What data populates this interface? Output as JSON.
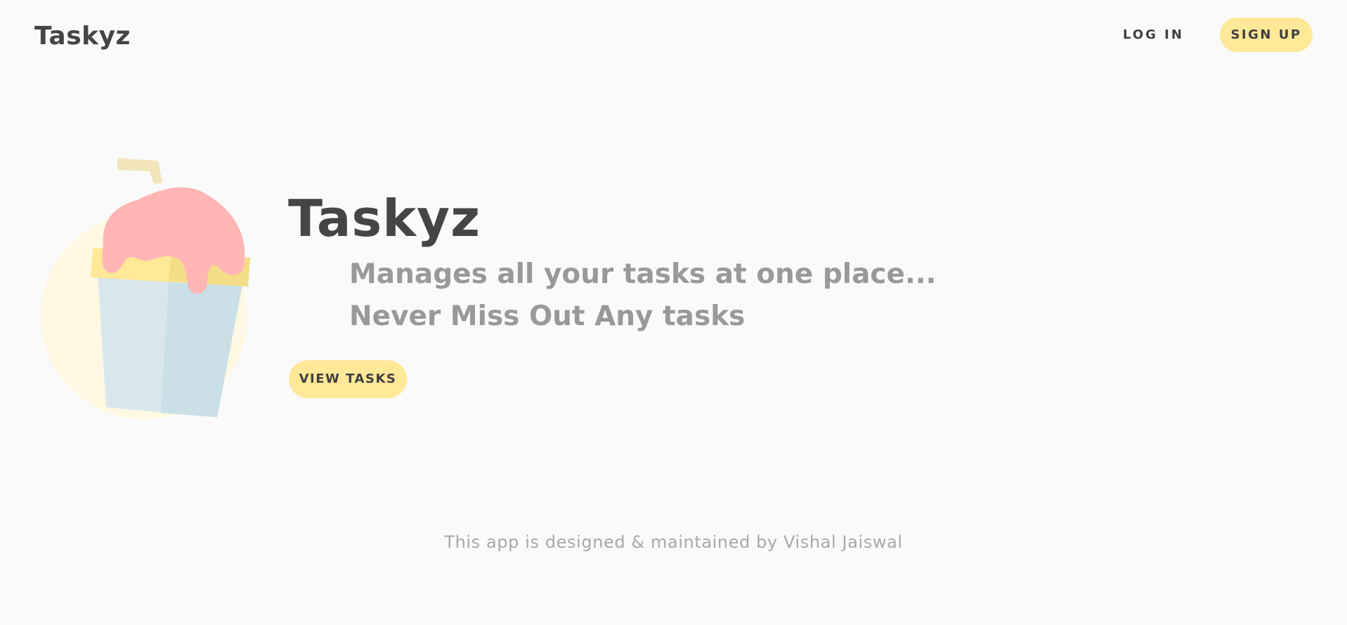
{
  "header": {
    "brand": "Taskyz",
    "login_label": "LOG IN",
    "signup_label": "SIGN UP"
  },
  "hero": {
    "title": "Taskyz",
    "line1": "Manages all your tasks at one place...",
    "line2": "Never Miss Out Any tasks",
    "cta_label": "VIEW TASKS",
    "illustration": "dessert-cup-icon"
  },
  "footer": {
    "credit": "This app is designed & maintained by Vishal Jaiswal"
  },
  "colors": {
    "background": "#fafafa",
    "accent": "#ffe898",
    "text_dark": "#454545",
    "text_muted": "#999999",
    "text_footer": "#a8a8a8",
    "topping": "#ffb6b5",
    "cup": "#d9e7ed"
  }
}
